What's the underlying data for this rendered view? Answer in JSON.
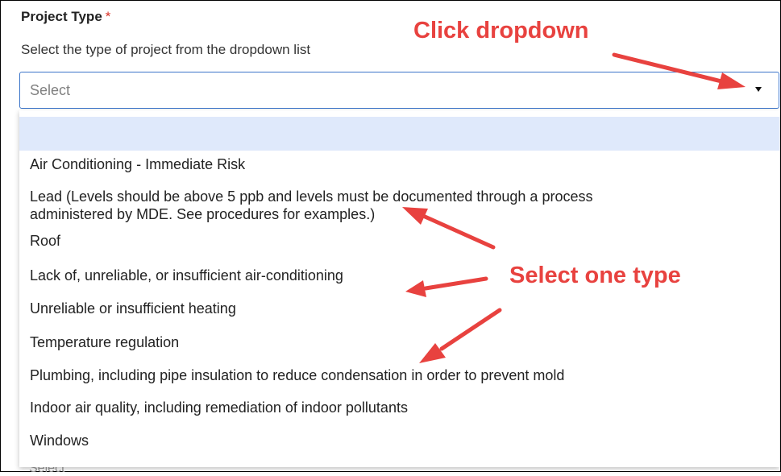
{
  "form": {
    "label": "Project Type",
    "required_mark": "*",
    "helper": "Select the type of project from the dropdown list",
    "placeholder": "Select",
    "next_field_placeholder": "Select"
  },
  "dropdown": {
    "options": [
      "",
      "Air Conditioning - Immediate Risk",
      "Lead (Levels should be above 5 ppb and levels must be documented through a process",
      "administered by MDE.  See procedures for examples.)",
      "Roof",
      "Lack of, unreliable, or insufficient air-conditioning",
      "Unreliable or insufficient heating",
      "Temperature regulation",
      "Plumbing, including pipe insulation to reduce condensation in order to prevent mold",
      "Indoor air quality, including remediation of indoor pollutants",
      "Windows"
    ]
  },
  "annotations": {
    "click_dropdown": "Click dropdown",
    "select_one_type": "Select one type",
    "color": "#e8423f"
  },
  "icons": {
    "caret": "chevron-down-icon"
  }
}
